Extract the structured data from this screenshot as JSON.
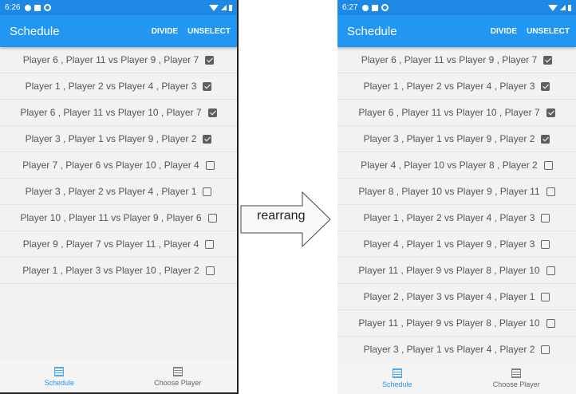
{
  "left": {
    "time": "6:26",
    "title": "Schedule",
    "divide_label": "DIVIDE",
    "unselect_label": "UNSELECT",
    "rows": [
      {
        "text": "Player 6 , Player 11  vs  Player 9 , Player 7",
        "checked": true
      },
      {
        "text": "Player 1 , Player 2  vs  Player 4 , Player 3",
        "checked": true
      },
      {
        "text": "Player 6 , Player 11  vs  Player 10 , Player 7",
        "checked": true
      },
      {
        "text": "Player 3 , Player 1  vs  Player 9 , Player 2",
        "checked": true
      },
      {
        "text": "Player 7 , Player 6  vs  Player 10 , Player 4",
        "checked": false
      },
      {
        "text": "Player 3 , Player 2  vs  Player 4 , Player 1",
        "checked": false
      },
      {
        "text": "Player 10 , Player 11  vs  Player 9 , Player 6",
        "checked": false
      },
      {
        "text": "Player 9 , Player 7  vs  Player 11 , Player 4",
        "checked": false
      },
      {
        "text": "Player 1 , Player 3  vs  Player 10 , Player 2",
        "checked": false
      }
    ],
    "nav": {
      "schedule": "Schedule",
      "choose_player": "Choose Player"
    }
  },
  "right": {
    "time": "6:27",
    "title": "Schedule",
    "divide_label": "DIVIDE",
    "unselect_label": "UNSELECT",
    "rows": [
      {
        "text": "Player 6 , Player 11  vs  Player 9 , Player 7",
        "checked": true
      },
      {
        "text": "Player 1 , Player 2  vs  Player 4 , Player 3",
        "checked": true
      },
      {
        "text": "Player 6 , Player 11  vs  Player 10 , Player 7",
        "checked": true
      },
      {
        "text": "Player 3 , Player 1  vs  Player 9 , Player 2",
        "checked": true
      },
      {
        "text": "Player 4 , Player 10  vs  Player 8 , Player 2",
        "checked": false
      },
      {
        "text": "Player 8 , Player 10  vs  Player 9 , Player 11",
        "checked": false
      },
      {
        "text": "Player 1 , Player 2  vs  Player 4 , Player 3",
        "checked": false
      },
      {
        "text": "Player 4 , Player 1  vs  Player 9 , Player 3",
        "checked": false
      },
      {
        "text": "Player 11 , Player 9  vs  Player 8 , Player 10",
        "checked": false
      },
      {
        "text": "Player 2 , Player 3  vs  Player 4 , Player 1",
        "checked": false
      },
      {
        "text": "Player 11 , Player 9  vs  Player 8 , Player 10",
        "checked": false
      },
      {
        "text": "Player 3 , Player 1  vs  Player 4 , Player 2",
        "checked": false
      }
    ],
    "nav": {
      "schedule": "Schedule",
      "choose_player": "Choose Player"
    }
  },
  "arrow_label": "rearrang",
  "colors": {
    "statusbar": "#1e88e5",
    "toolbar": "#2196f3",
    "nav_active": "#2196f3"
  }
}
